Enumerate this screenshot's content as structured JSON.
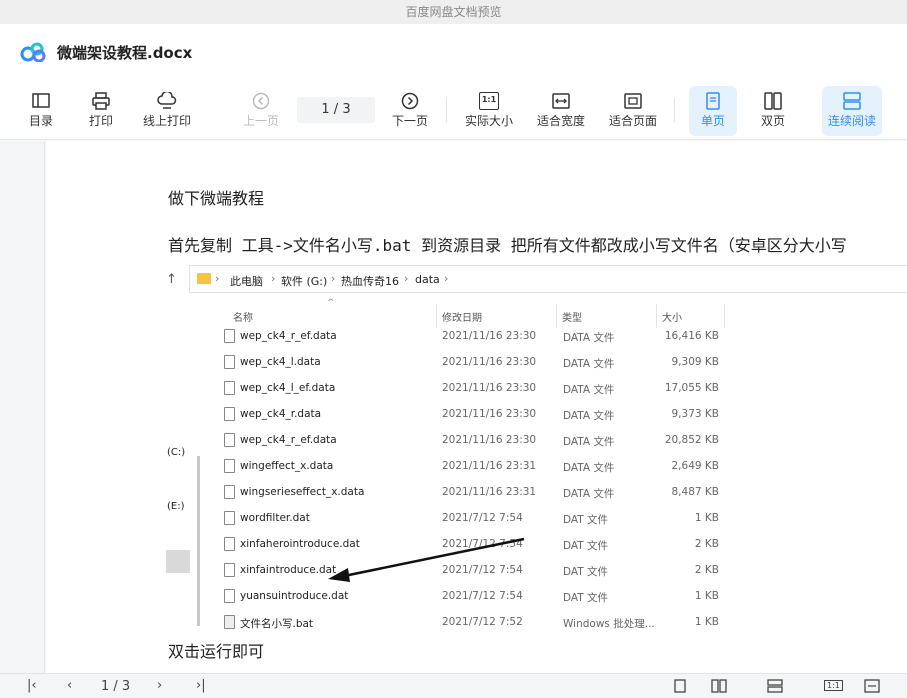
{
  "window_title": "百度网盘文档预览",
  "document": {
    "title": "微端架设教程.docx"
  },
  "toolbar": {
    "toc": "目录",
    "print": "打印",
    "online_print": "线上打印",
    "prev_page": "上一页",
    "page_indicator": "1 / 3",
    "next_page": "下一页",
    "actual_size": "实际大小",
    "fit_width": "适合宽度",
    "fit_page": "适合页面",
    "single_page": "单页",
    "double_page": "双页",
    "continuous": "连续阅读",
    "actual_size_glyph": "1:1"
  },
  "content": {
    "heading": "做下微端教程",
    "line1": "首先复制    工具->文件名小写.bat  到资源目录 把所有文件都改成小写文件名（安卓区分大小写",
    "line2": "双击运行即可"
  },
  "explorer": {
    "up_glyph": "↑",
    "sort_glyph": "^",
    "breadcrumb": [
      "此电脑",
      "软件 (G:)",
      "热血传奇16",
      "data"
    ],
    "nav_labels": [
      "(C:)",
      "(E:)"
    ],
    "columns": {
      "name": "名称",
      "date": "修改日期",
      "type": "类型",
      "size": "大小"
    },
    "files": [
      {
        "name": "wep_ck4_r_ef.data",
        "date": "2021/11/16 23:30",
        "type": "DATA 文件",
        "size": "16,416 KB"
      },
      {
        "name": "wep_ck4_l.data",
        "date": "2021/11/16 23:30",
        "type": "DATA 文件",
        "size": "9,309 KB"
      },
      {
        "name": "wep_ck4_l_ef.data",
        "date": "2021/11/16 23:30",
        "type": "DATA 文件",
        "size": "17,055 KB"
      },
      {
        "name": "wep_ck4_r.data",
        "date": "2021/11/16 23:30",
        "type": "DATA 文件",
        "size": "9,373 KB"
      },
      {
        "name": "wep_ck4_r_ef.data",
        "date": "2021/11/16 23:30",
        "type": "DATA 文件",
        "size": "20,852 KB"
      },
      {
        "name": "wingeffect_x.data",
        "date": "2021/11/16 23:31",
        "type": "DATA 文件",
        "size": "2,649 KB"
      },
      {
        "name": "wingserieseffect_x.data",
        "date": "2021/11/16 23:31",
        "type": "DATA 文件",
        "size": "8,487 KB"
      },
      {
        "name": "wordfilter.dat",
        "date": "2021/7/12 7:54",
        "type": "DAT 文件",
        "size": "1 KB"
      },
      {
        "name": "xinfaherointroduce.dat",
        "date": "2021/7/12 7:54",
        "type": "DAT 文件",
        "size": "2 KB"
      },
      {
        "name": "xinfaintroduce.dat",
        "date": "2021/7/12 7:54",
        "type": "DAT 文件",
        "size": "2 KB"
      },
      {
        "name": "yuansuintroduce.dat",
        "date": "2021/7/12 7:54",
        "type": "DAT 文件",
        "size": "1 KB"
      },
      {
        "name": "文件名小写.bat",
        "date": "2021/7/12 7:52",
        "type": "Windows 批处理...",
        "size": "1 KB"
      }
    ]
  },
  "bottom_bar": {
    "page_indicator": "1 / 3"
  },
  "colors": {
    "accent": "#2f8ef5",
    "active_bg": "#e5f2fd"
  }
}
